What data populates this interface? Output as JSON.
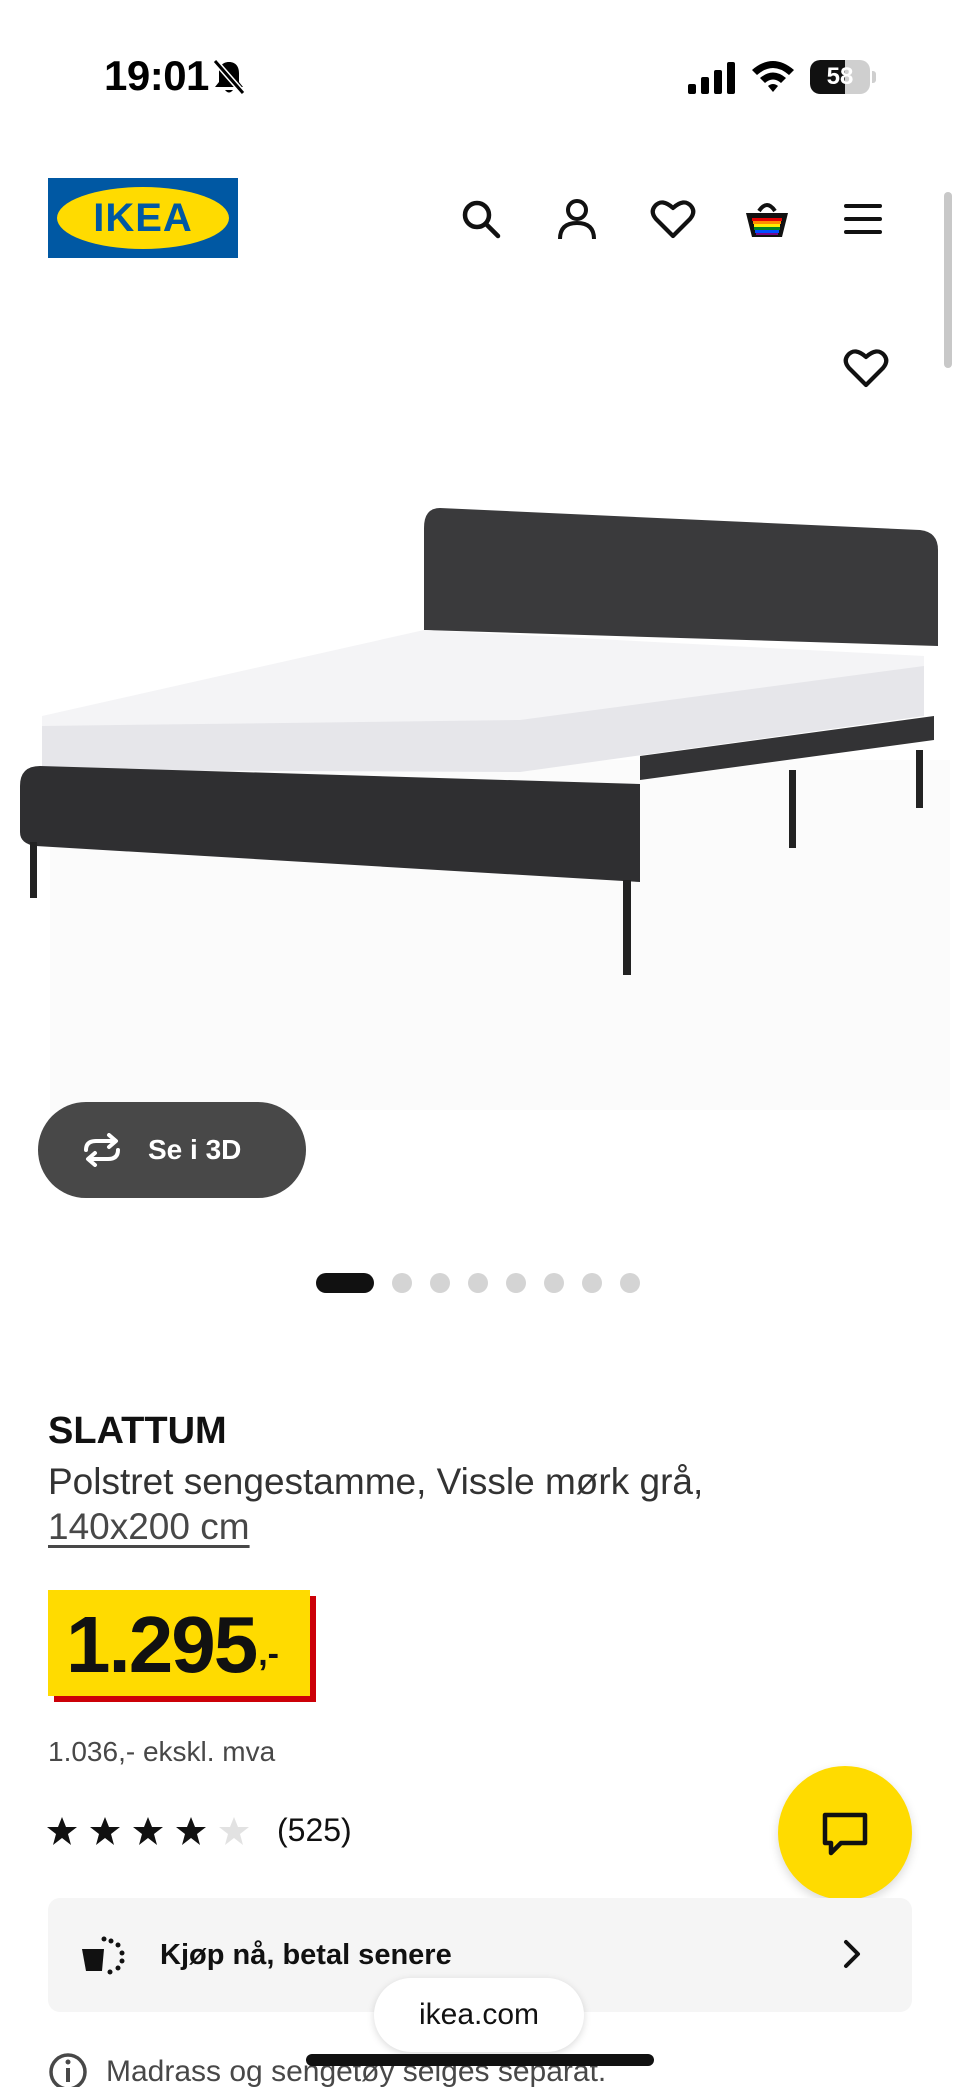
{
  "status_bar": {
    "time": "19:01",
    "battery_percent": 58,
    "battery_label": "58"
  },
  "header": {
    "logo_text": "IKEA",
    "icons": [
      "search-icon",
      "account-icon",
      "favorites-icon",
      "cart-icon",
      "menu-icon"
    ]
  },
  "gallery": {
    "view_3d_label": "Se i 3D",
    "image_count": 8,
    "active_index": 0
  },
  "product": {
    "name": "SLATTUM",
    "description": "Polstret sengestamme, Vissle mørk grå,",
    "size": "140x200 cm",
    "price_main": "1.295",
    "price_suffix": ",-",
    "price_excl": "1.036,- ekskl. mva",
    "rating": 4.0,
    "rating_max": 5,
    "review_count": "(525)"
  },
  "colors": {
    "ikea_blue": "#0058a3",
    "ikea_yellow": "#ffdb00",
    "price_red": "#cc0008"
  },
  "payment": {
    "label": "Kjøp nå, betal senere"
  },
  "notice": {
    "text": "Madrass og sengetøy selges separat."
  },
  "browser": {
    "url": "ikea.com"
  }
}
